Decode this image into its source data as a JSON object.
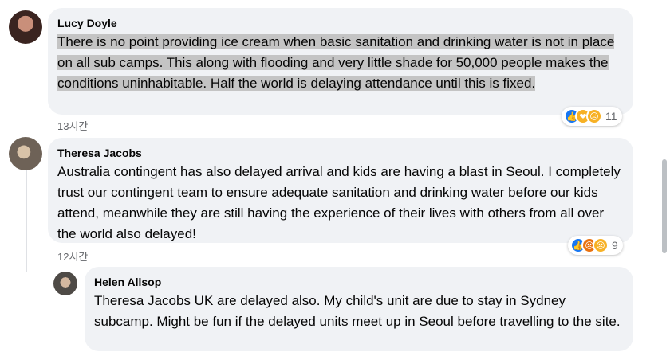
{
  "comments": [
    {
      "author": "Lucy Doyle",
      "text": "There is no point providing ice cream when basic sanitation and drinking water is not in place on all sub camps. This along with flooding and very little shade for 50,000 people makes the conditions uninhabitable. Half the world is delaying attendance until this is fixed.",
      "time": "13시간",
      "reaction_count": "11",
      "reaction_icons": [
        "like-icon",
        "care-icon",
        "sad-icon"
      ]
    },
    {
      "author": "Theresa Jacobs",
      "text": "Australia contingent has also delayed arrival and kids are having a blast in Seoul. I completely trust our contingent team to ensure adequate sanitation and drinking water before our kids attend, meanwhile they are still having the experience of their lives with others from all over the world also delayed!",
      "time": "12시간",
      "reaction_count": "9",
      "reaction_icons": [
        "like-icon",
        "angry-icon",
        "sad-icon"
      ]
    },
    {
      "author": "Helen Allsop",
      "text": "Theresa Jacobs UK are delayed also. My child's unit are due to stay in Sydney subcamp. Might be fun if the delayed units meet up in Seoul before travelling to the site."
    }
  ],
  "colors": {
    "like": "#1877f2",
    "sad": "#f7b125",
    "angry": "#e9710f",
    "care": "#f7b125"
  }
}
